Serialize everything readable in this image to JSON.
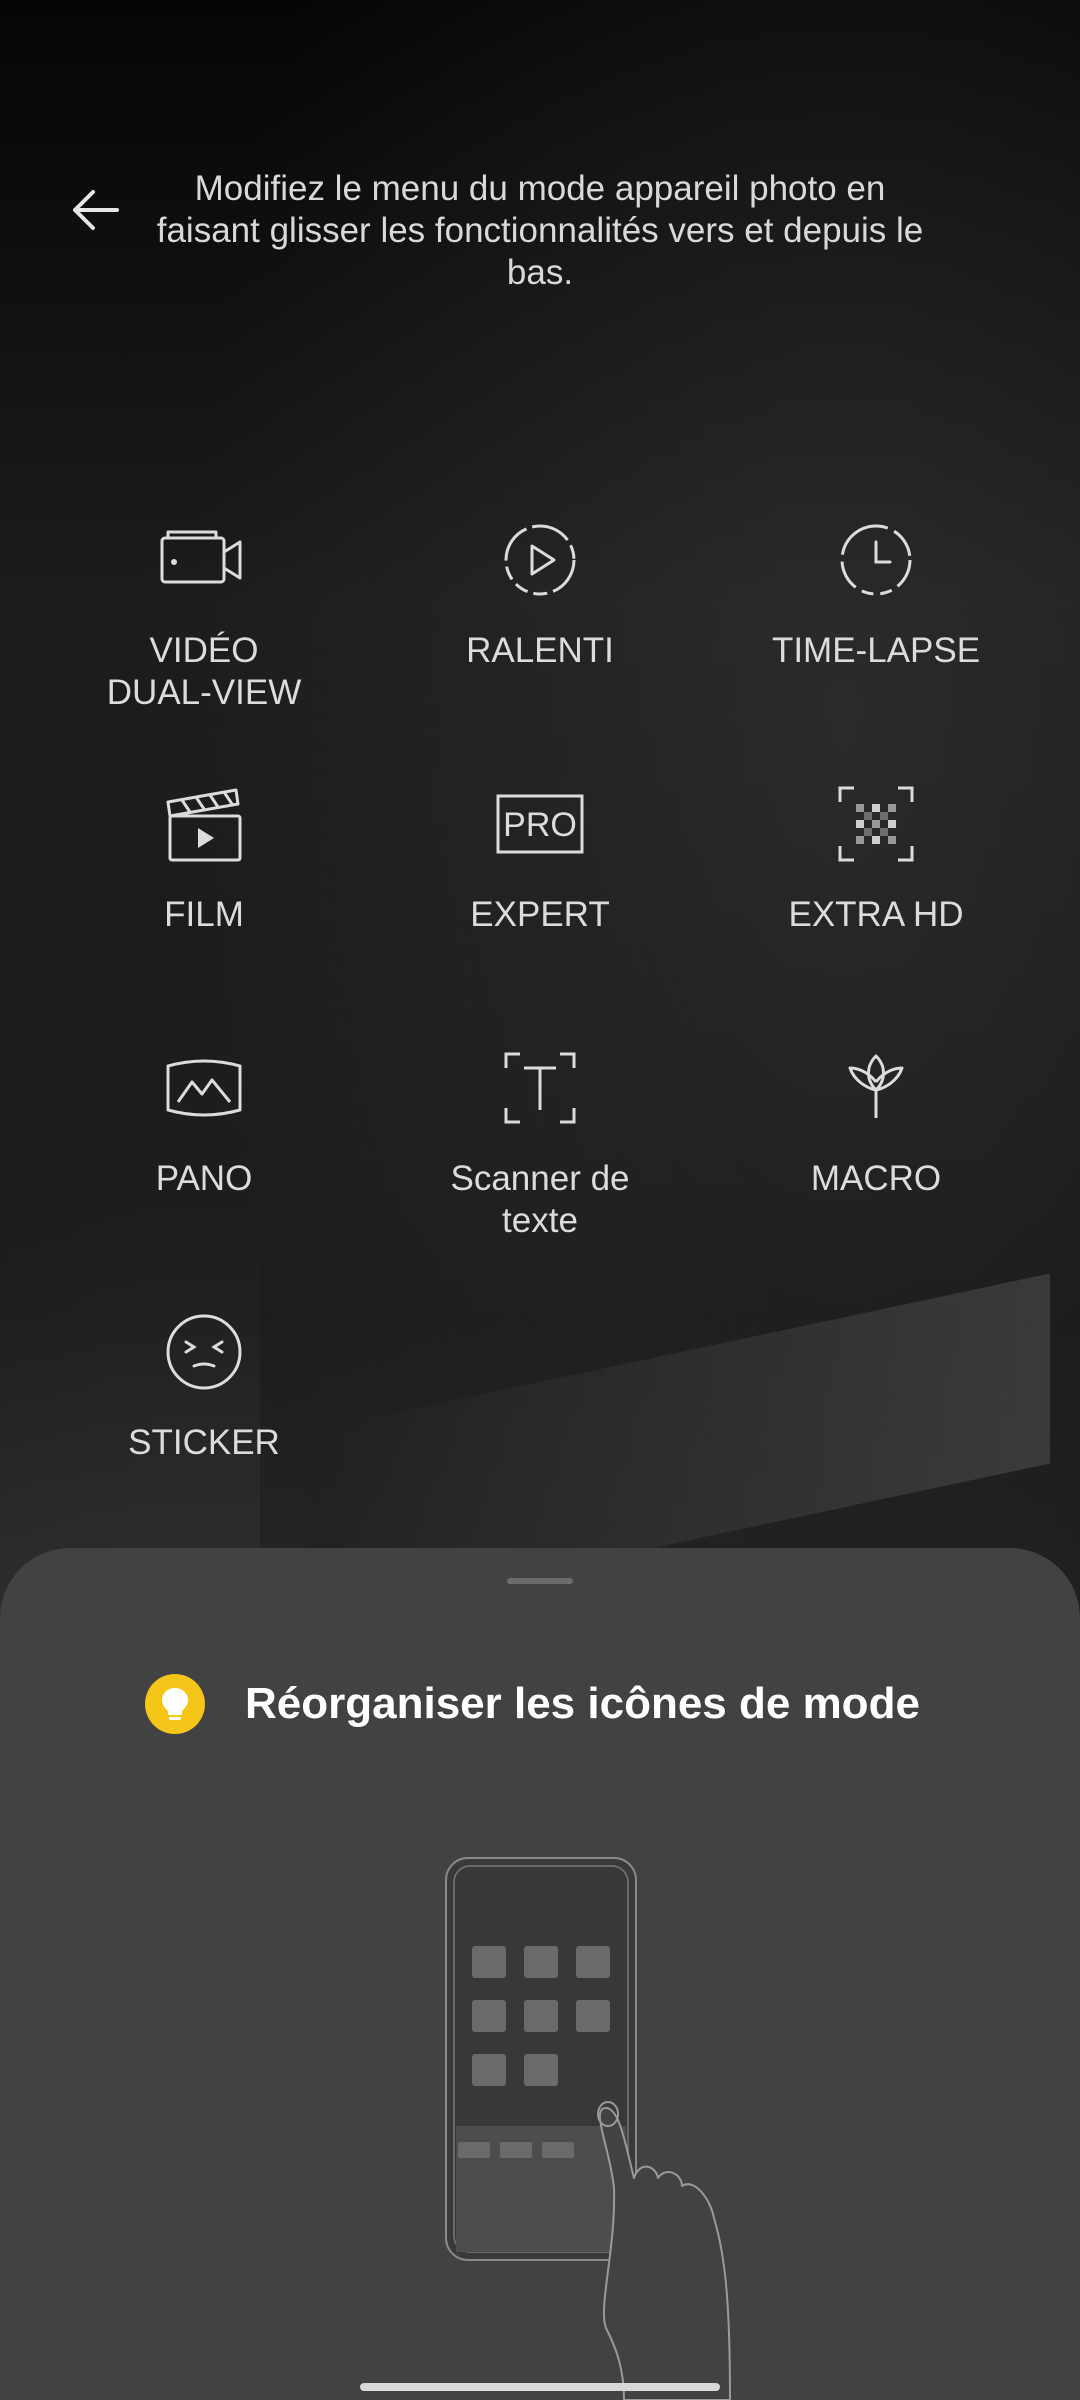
{
  "header": {
    "back_icon": "arrow-left-icon",
    "instruction": "Modifiez le menu du mode appareil photo en faisant glisser les fonctionnalités vers et depuis le bas."
  },
  "modes": [
    {
      "icon": "dual-view-video-icon",
      "label": "VIDÉO\nDUAL-VIEW"
    },
    {
      "icon": "slow-motion-icon",
      "label": "RALENTI"
    },
    {
      "icon": "time-lapse-icon",
      "label": "TIME-LAPSE"
    },
    {
      "icon": "film-clapper-icon",
      "label": "FILM"
    },
    {
      "icon": "pro-icon",
      "label": "EXPERT"
    },
    {
      "icon": "extra-hd-icon",
      "label": "EXTRA HD"
    },
    {
      "icon": "panorama-icon",
      "label": "PANO"
    },
    {
      "icon": "text-scanner-icon",
      "label": "Scanner de\ntexte"
    },
    {
      "icon": "macro-flower-icon",
      "label": "MACRO"
    },
    {
      "icon": "sticker-face-icon",
      "label": "STICKER"
    }
  ],
  "sheet": {
    "tip_icon": "lightbulb-icon",
    "tip_title": "Réorganiser les icônes de mode",
    "illustration": "phone-drag-hand-illustration",
    "pro_badge_text": "PRO"
  },
  "colors": {
    "background": "#0f0f0f",
    "sheet": "#424242",
    "accent_yellow": "#f5c518",
    "text": "#dcdcdc"
  }
}
